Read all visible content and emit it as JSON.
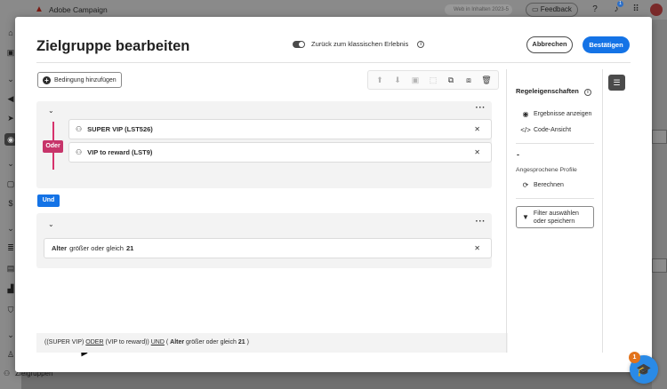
{
  "app": {
    "name": "Adobe Campaign",
    "search_text": "Web in Inhalten 2023-5",
    "feedback_label": "Feedback",
    "notification_count": "1",
    "bottom_nav_label": "Zielgruppen"
  },
  "modal": {
    "title": "Zielgruppe bearbeiten",
    "toggle_label": "Zurück zum klassischen Erlebnis",
    "cancel_label": "Abbrechen",
    "confirm_label": "Bestätigen"
  },
  "editor": {
    "add_condition_label": "Bedingung hinzufügen",
    "group1": {
      "operator": "Oder",
      "rules": [
        {
          "name": "SUPER VIP (LST526)"
        },
        {
          "name": "VIP to reward (LST9)"
        }
      ]
    },
    "and_operator": "Und",
    "group2": {
      "rule": {
        "field": "Alter",
        "operator": "größer oder gleich",
        "value": "21"
      }
    }
  },
  "summary": {
    "p1": "((SUPER VIP)",
    "op1": "ODER",
    "p2": "(VIP to reward))",
    "op2": "UND",
    "p3": "(",
    "field": "Alter",
    "operator": "größer oder gleich",
    "value": "21",
    "p4": ")"
  },
  "rule_properties": {
    "title": "Regeleigenschaften",
    "show_results": "Ergebnisse anzeigen",
    "code_view": "Code-Ansicht",
    "count_value": "-",
    "profiles_label": "Angesprochene Profile",
    "calculate_label": "Berechnen",
    "filter_line1": "Filter auswählen",
    "filter_line2": "oder speichern"
  },
  "help": {
    "badge_count": "1"
  }
}
